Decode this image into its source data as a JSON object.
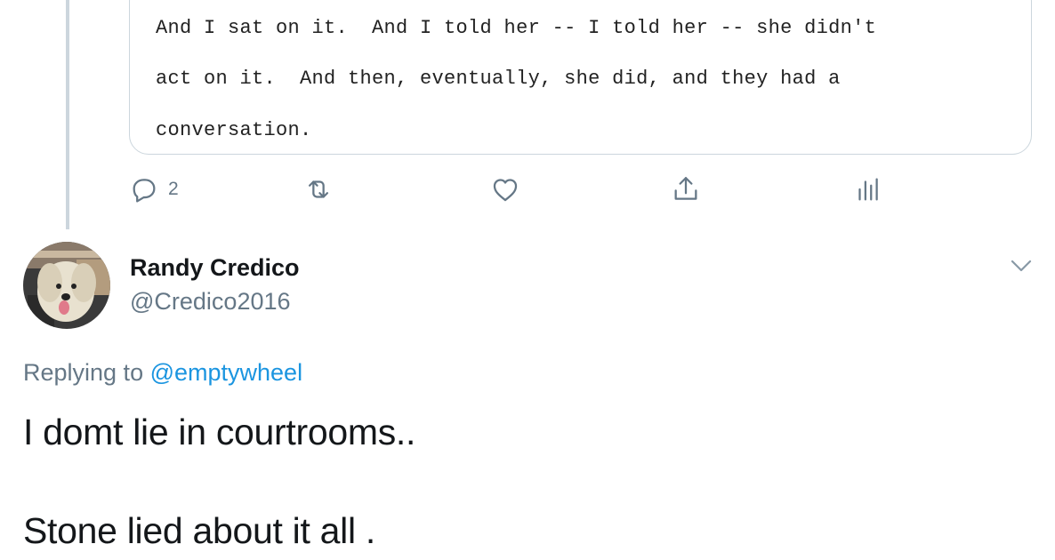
{
  "quoted_tweet": {
    "lines": [
      "And I sat on it.  And I told her -- I told her -- she didn't",
      "act on it.  And then, eventually, she did, and they had a",
      "conversation."
    ],
    "actions": {
      "reply_count": "2",
      "reply_icon": "reply-bubble-icon",
      "retweet_icon": "retweet-icon",
      "like_icon": "heart-icon",
      "share_icon": "share-icon",
      "analytics_icon": "analytics-icon"
    }
  },
  "tweet": {
    "author_name": "Randy Credico",
    "author_handle": "@Credico2016",
    "replying_prefix": "Replying to ",
    "replying_to": "@emptywheel",
    "text_line_1": "I domt lie in courtrooms..",
    "text_line_2": "Stone lied about it all .",
    "menu_icon": "chevron-down-icon"
  },
  "colors": {
    "secondary_text": "#657786",
    "link": "#1b95e0",
    "primary_text": "#14171a",
    "border": "#ccd6dd"
  }
}
